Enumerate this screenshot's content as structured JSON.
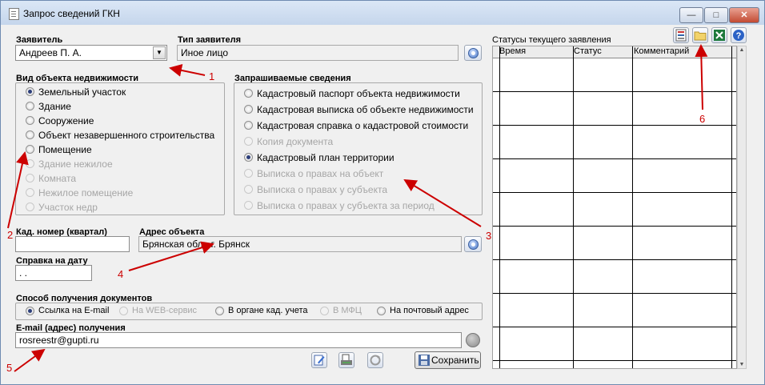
{
  "window": {
    "title": "Запрос сведений ГКН",
    "controls": {
      "minimize": "—",
      "maximize": "□",
      "close": "✕"
    }
  },
  "applicant": {
    "label": "Заявитель",
    "value": "Андреев П. А.",
    "type_label": "Тип заявителя",
    "type_value": "Иное лицо"
  },
  "object_kind": {
    "label": "Вид объекта недвижимости",
    "options": [
      {
        "label": "Земельный участок",
        "selected": true,
        "disabled": false
      },
      {
        "label": "Здание",
        "selected": false,
        "disabled": false
      },
      {
        "label": "Сооружение",
        "selected": false,
        "disabled": false
      },
      {
        "label": "Объект незавершенного строительства",
        "selected": false,
        "disabled": false
      },
      {
        "label": "Помещение",
        "selected": false,
        "disabled": false
      },
      {
        "label": "Здание нежилое",
        "selected": false,
        "disabled": true
      },
      {
        "label": "Комната",
        "selected": false,
        "disabled": true
      },
      {
        "label": "Нежилое помещение",
        "selected": false,
        "disabled": true
      },
      {
        "label": "Участок недр",
        "selected": false,
        "disabled": true
      }
    ]
  },
  "requested_info": {
    "label": "Запрашиваемые сведения",
    "options": [
      {
        "label": "Кадастровый паспорт объекта недвижимости",
        "selected": false,
        "disabled": false
      },
      {
        "label": "Кадастровая выписка об объекте недвижимости",
        "selected": false,
        "disabled": false
      },
      {
        "label": "Кадастровая справка о кадастровой стоимости",
        "selected": false,
        "disabled": false
      },
      {
        "label": "Копия документа",
        "selected": false,
        "disabled": true
      },
      {
        "label": "Кадастровый план территории",
        "selected": true,
        "disabled": false
      },
      {
        "label": "Выписка о правах на объект",
        "selected": false,
        "disabled": true
      },
      {
        "label": "Выписка о правах у субъекта",
        "selected": false,
        "disabled": true
      },
      {
        "label": "Выписка о правах у субъекта за период",
        "selected": false,
        "disabled": true
      }
    ]
  },
  "cadastral": {
    "label": "Кад. номер (квартал)",
    "value": ""
  },
  "address": {
    "label": "Адрес объекта",
    "value": "Брянская обл., г. Брянск"
  },
  "report_date": {
    "label": "Справка на дату",
    "value": " .  ."
  },
  "delivery": {
    "label": "Способ получения документов",
    "options": [
      {
        "label": "Ссылка на E-mail",
        "selected": true,
        "disabled": false
      },
      {
        "label": "На WEB-сервис",
        "selected": false,
        "disabled": true
      },
      {
        "label": "В органе кад. учета",
        "selected": false,
        "disabled": false
      },
      {
        "label": "В МФЦ",
        "selected": false,
        "disabled": true
      },
      {
        "label": "На почтовый адрес",
        "selected": false,
        "disabled": false
      }
    ]
  },
  "email": {
    "label": "E-mail (адрес) получения",
    "value": "rosreestr@gupti.ru"
  },
  "actions": {
    "save_label": "Сохранить"
  },
  "statuses": {
    "label": "Статусы текущего заявления",
    "columns": [
      "Время",
      "Статус",
      "Комментарий"
    ]
  },
  "annotations": [
    "1",
    "2",
    "3",
    "4",
    "5",
    "6"
  ],
  "colors": {
    "annotation": "#cc0000",
    "window_bg": "#f0f0f0",
    "titlebar": "#c5d6ec"
  },
  "icons": [
    "document-icon",
    "edit-icon",
    "scanner-icon",
    "refresh-icon",
    "save-disk-icon",
    "print-icon",
    "folder-icon",
    "excel-icon",
    "help-icon"
  ]
}
